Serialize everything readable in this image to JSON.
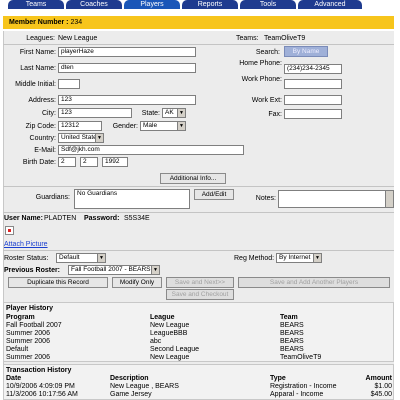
{
  "tabs": [
    "Teams",
    "Coaches",
    "Players",
    "Reports",
    "Tools",
    "Advanced"
  ],
  "member": {
    "label": "Member Number :",
    "value": "234"
  },
  "league": {
    "label": "Leagues:",
    "value": "New League"
  },
  "teams": {
    "label": "Teams:",
    "value": "TeamOliveT9"
  },
  "form": {
    "first_name_label": "First Name:",
    "first_name": "playerHaze",
    "last_name_label": "Last Name:",
    "last_name": "dten",
    "middle_initial_label": "Middle Initial:",
    "middle_initial": "",
    "address_label": "Address:",
    "address": "123",
    "city_label": "City:",
    "city": "123",
    "state_label": "State:",
    "state": "AK",
    "zip_label": "Zip Code:",
    "zip": "12312",
    "gender_label": "Gender:",
    "gender": "Male",
    "country_label": "Country:",
    "country": "United States",
    "email_label": "E-Mail:",
    "email": "Sdf@jkh.com",
    "birth_label": "Birth Date:",
    "birth_month": "2",
    "birth_day": "2",
    "birth_year": "1992",
    "search_label": "Search:",
    "search_button": "By Name",
    "home_phone_label": "Home Phone:",
    "home_phone": "(234)234-2345",
    "work_phone_label": "Work Phone:",
    "work_phone": "",
    "work_ext_label": "Work Ext:",
    "work_ext": "",
    "fax_label": "Fax:",
    "fax": "",
    "additional_info": "Additional Info...",
    "guardians_label": "Guardians:",
    "guardians_value": "No Guardians",
    "add_edit": "Add/Edit",
    "notes_label": "Notes:"
  },
  "credentials": {
    "user_label": "User Name:",
    "user": "PLADTEN",
    "password_label": "Password:",
    "password": "S5S34E"
  },
  "attach_picture": "Attach Picture",
  "roster": {
    "status_label": "Roster Status:",
    "status": "Default",
    "reg_label": "Reg Method:",
    "reg": "By Internet",
    "prev_label": "Previous Roster:",
    "prev": "Fall Football 2007 - BEARS"
  },
  "buttons": {
    "duplicate": "Duplicate this Record",
    "modify": "Modify Only",
    "save_next": "Save and Next>>",
    "save_add": "Save and Add Another Players",
    "save_checkout": "Save and Checkout"
  },
  "player_history": {
    "title": "Player History",
    "headers": [
      "Program",
      "League",
      "Team"
    ],
    "rows": [
      [
        "Fall Football 2007",
        "New League",
        "BEARS"
      ],
      [
        "Summer 2006",
        "LeagueBBB",
        "BEARS"
      ],
      [
        "Summer 2006",
        "abc",
        "BEARS"
      ],
      [
        "Default",
        "Second League",
        "BEARS"
      ],
      [
        "Summer 2006",
        "New League",
        "TeamOliveT9"
      ]
    ]
  },
  "transaction_history": {
    "title": "Transaction History",
    "headers": [
      "Date",
      "Description",
      "Type",
      "Amount"
    ],
    "rows": [
      [
        "10/9/2006 4:09:09 PM",
        "New League , BEARS",
        "Registration - Income",
        "$1.00"
      ],
      [
        "11/3/2006 10:17:56 AM",
        "Game Jersey",
        "Apparal - Income",
        "$45.00"
      ]
    ]
  },
  "colors": {
    "tab": "#1f3b8f",
    "member_bar": "#f7c51c",
    "link": "#1a3fd0"
  }
}
